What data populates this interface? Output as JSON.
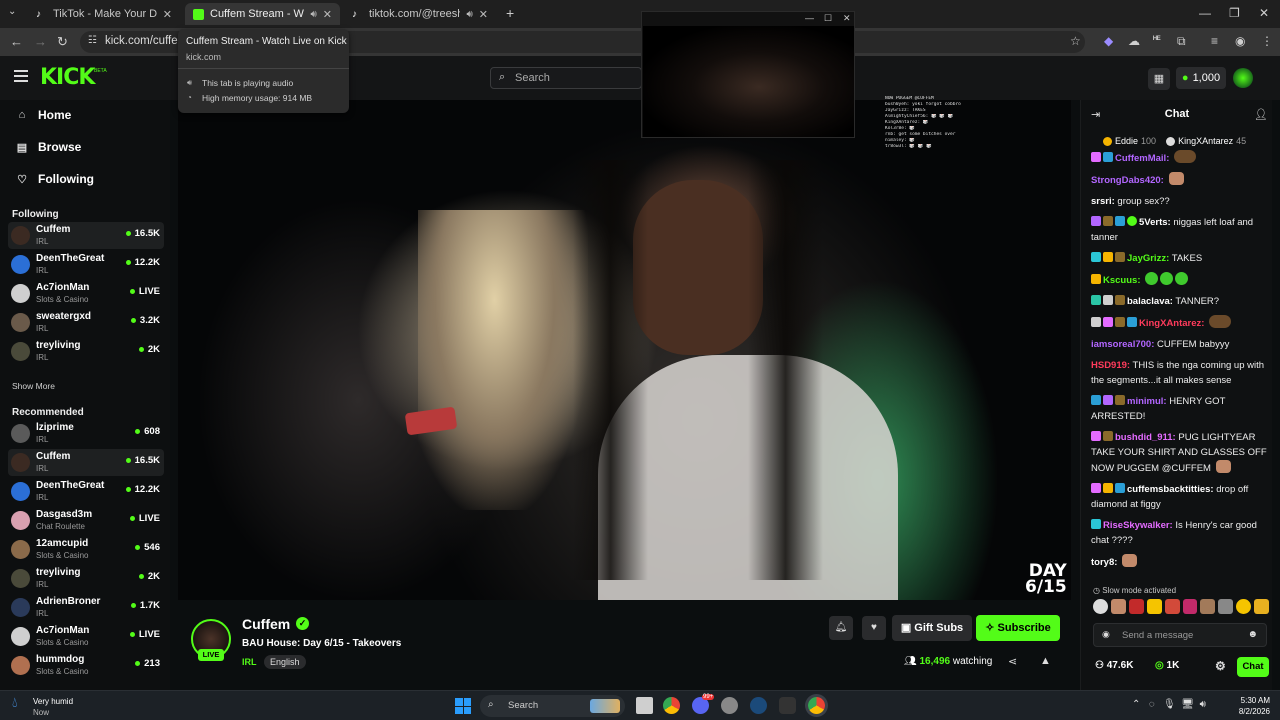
{
  "browser": {
    "tabs": [
      {
        "title": "TikTok - Make Your Day",
        "active": false
      },
      {
        "title": "Cuffem Stream - Watch Live on Kick",
        "active": true
      },
      {
        "title": "tiktok.com/@treeshforwhat",
        "active": false
      }
    ],
    "url": "kick.com/cuffem",
    "tooltip": {
      "title": "Cuffem Stream - Watch Live on Kick",
      "domain": "kick.com",
      "audio": "This tab is playing audio",
      "memory": "High memory usage: 914 MB"
    }
  },
  "header": {
    "logo": "KICK",
    "beta": "BETA",
    "search_placeholder": "Search",
    "kicks": "1,000"
  },
  "sidebar": {
    "nav": [
      {
        "label": "Home",
        "icon": "home-icon"
      },
      {
        "label": "Browse",
        "icon": "browse-icon"
      },
      {
        "label": "Following",
        "icon": "heart-icon"
      }
    ],
    "following_title": "Following",
    "following": [
      {
        "name": "Cuffem",
        "category": "IRL",
        "viewers": "16.5K"
      },
      {
        "name": "DeenTheGreat",
        "category": "IRL",
        "viewers": "12.2K"
      },
      {
        "name": "Ac7ionMan",
        "category": "Slots & Casino",
        "viewers": "LIVE"
      },
      {
        "name": "sweatergxd",
        "category": "IRL",
        "viewers": "3.2K"
      },
      {
        "name": "treyliving",
        "category": "IRL",
        "viewers": "2K"
      }
    ],
    "show_more": "Show More",
    "recommended_title": "Recommended",
    "recommended": [
      {
        "name": "lziprime",
        "category": "IRL",
        "viewers": "608"
      },
      {
        "name": "Cuffem",
        "category": "IRL",
        "viewers": "16.5K"
      },
      {
        "name": "DeenTheGreat",
        "category": "IRL",
        "viewers": "12.2K"
      },
      {
        "name": "Dasgasd3m",
        "category": "Chat Roulette",
        "viewers": "LIVE"
      },
      {
        "name": "12amcupid",
        "category": "Slots & Casino",
        "viewers": "546"
      },
      {
        "name": "treyliving",
        "category": "IRL",
        "viewers": "2K"
      },
      {
        "name": "AdrienBroner",
        "category": "IRL",
        "viewers": "1.7K"
      },
      {
        "name": "Ac7ionMan",
        "category": "Slots & Casino",
        "viewers": "LIVE"
      },
      {
        "name": "hummdog",
        "category": "Slots & Casino",
        "viewers": "213"
      }
    ]
  },
  "video": {
    "day_badge_line1": "DAY",
    "day_badge_line2": "6/15",
    "overlay_chat": [
      "NOW PUGGEM @CUFFEM",
      "bush0yeh: yoki forgot cobbro",
      "JayGrizz: TAKES",
      "AlmightyChief56: 🎲 🎲 🎲",
      "KingXAntarez: 🎲",
      "Kol3r8e: 🎲",
      "rnb: get some bitches over",
      "nimaley: 🎲",
      "tr8ow3l: 🎲 🎲 🎲"
    ]
  },
  "stream": {
    "streamer": "Cuffem",
    "live_badge": "LIVE",
    "title": "BAU House: Day 6/15 - Takeovers",
    "category": "IRL",
    "language": "English",
    "gift_subs": "Gift Subs",
    "subscribe": "Subscribe",
    "viewers": "16,496",
    "watching_label": "watching"
  },
  "chat": {
    "title": "Chat",
    "top_gifters": [
      {
        "name": "Eddie",
        "count": "100",
        "color": "#f5b400"
      },
      {
        "name": "KingXAntarez",
        "count": "45",
        "color": "#dddddd"
      }
    ],
    "messages": [
      {
        "user": "CuffemMail:",
        "color": "#b266ff",
        "text": "",
        "emotes": [
          "b"
        ]
      },
      {
        "user": "StrongDabs420:",
        "color": "#b266ff",
        "text": "",
        "emotes": [
          "p"
        ]
      },
      {
        "user": "srsri:",
        "color": "#ffffff",
        "text": "group sex??",
        "emotes": []
      },
      {
        "user": "5Verts:",
        "color": "#ffffff",
        "text": "niggas left loaf and tanner",
        "emotes": []
      },
      {
        "user": "JayGrizz:",
        "color": "#53fc18",
        "text": "TAKES",
        "emotes": []
      },
      {
        "user": "Kscuus:",
        "color": "#53fc18",
        "text": "",
        "emotes": [
          "g",
          "g",
          "g"
        ]
      },
      {
        "user": "balaclava:",
        "color": "#ffffff",
        "text": "TANNER?",
        "emotes": []
      },
      {
        "user": "KingXAntarez:",
        "color": "#ff3b5c",
        "text": "",
        "emotes": [
          "b"
        ]
      },
      {
        "user": "iamsoreal700:",
        "color": "#b266ff",
        "text": "CUFFEM babyyy",
        "emotes": []
      },
      {
        "user": "HSD919:",
        "color": "#ff3b5c",
        "text": "THIS is the nga coming up with the segments...it all makes sense",
        "emotes": []
      },
      {
        "user": "minimul:",
        "color": "#b266ff",
        "text": "HENRY GOT ARRESTED!",
        "emotes": []
      },
      {
        "user": "bushdid_911:",
        "color": "#e36bff",
        "text": "PUG LIGHTYEAR TAKE YOUR SHIRT AND GLASSES OFF NOW PUGGEM @CUFFEM",
        "emotes": [
          "p"
        ]
      },
      {
        "user": "cuffemsbacktitties:",
        "color": "#ffffff",
        "text": "drop off diamond at figgy",
        "emotes": []
      },
      {
        "user": "RiseSkywalker:",
        "color": "#e36bff",
        "text": "Is Henry's car good chat ????",
        "emotes": []
      },
      {
        "user": "tory8:",
        "color": "#ffffff",
        "text": "",
        "emotes": [
          "p"
        ]
      }
    ],
    "slow_mode": "Slow mode activated",
    "input_placeholder": "Send a message",
    "footer_stat1": "47.6K",
    "footer_stat2": "1K",
    "send_label": "Chat"
  },
  "taskbar": {
    "weather": "Very humid",
    "weather_sub": "Now",
    "search_placeholder": "Search",
    "time": "5:30 AM",
    "date": "8/2/2026",
    "badge_count": "99+"
  }
}
